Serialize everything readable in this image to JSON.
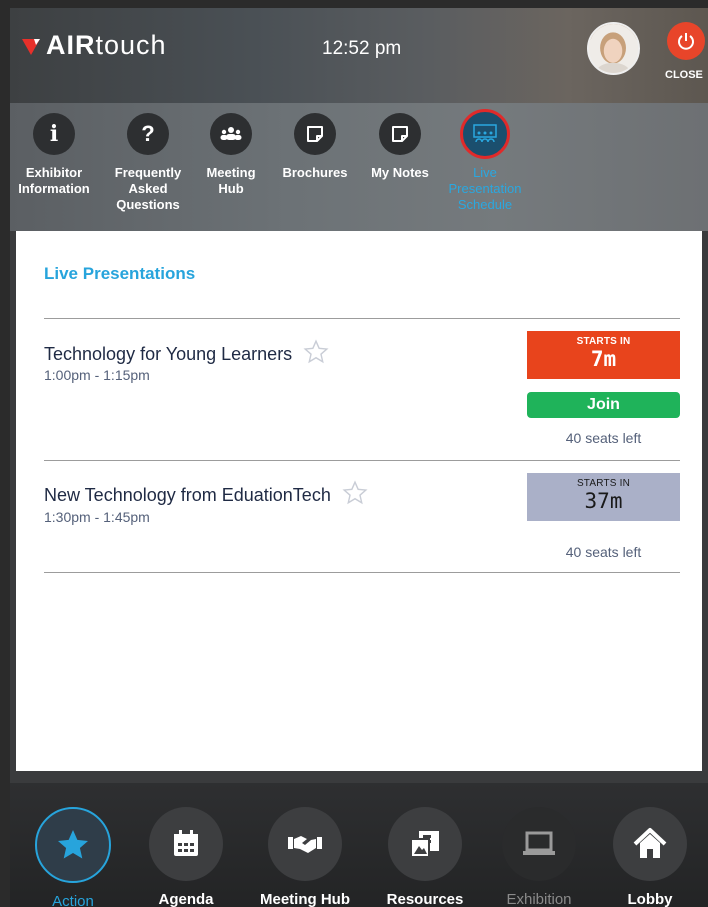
{
  "header": {
    "brand_bold": "AIR",
    "brand_rest": "touch",
    "time": "12:52 pm",
    "close_label": "CLOSE"
  },
  "toolbar": {
    "items": [
      {
        "label": "Exhibitor Information",
        "icon": "info-icon"
      },
      {
        "label": "Frequently Asked Questions",
        "icon": "question-icon"
      },
      {
        "label": "Meeting Hub",
        "icon": "people-icon"
      },
      {
        "label": "Brochures",
        "icon": "note-icon"
      },
      {
        "label": "My Notes",
        "icon": "note-icon"
      },
      {
        "label": "Live Presentation Schedule",
        "icon": "presentation-icon"
      }
    ]
  },
  "panel": {
    "title": "Live Presentations",
    "sessions": [
      {
        "title": "Technology for Young Learners",
        "time": "1:00pm - 1:15pm",
        "starts_label": "STARTS IN",
        "starts_value": "7m",
        "join_label": "Join",
        "seats": "40 seats left"
      },
      {
        "title": "New Technology from EduationTech",
        "time": "1:30pm - 1:45pm",
        "starts_label": "STARTS IN",
        "starts_value": "37m",
        "seats": "40 seats left"
      }
    ]
  },
  "bottom_nav": {
    "items": [
      {
        "label": "Action",
        "icon": "star-icon"
      },
      {
        "label": "Agenda",
        "icon": "calendar-icon"
      },
      {
        "label": "Meeting Hub",
        "icon": "handshake-icon"
      },
      {
        "label": "Resources",
        "icon": "resources-icon"
      },
      {
        "label": "Exhibition",
        "icon": "laptop-icon"
      },
      {
        "label": "Lobby",
        "icon": "home-icon"
      }
    ]
  },
  "colors": {
    "accent": "#27a4dc",
    "close": "#e8452a",
    "starts_hot": "#e8441c",
    "starts_cool": "#aab0c8",
    "join": "#1fb35a"
  }
}
